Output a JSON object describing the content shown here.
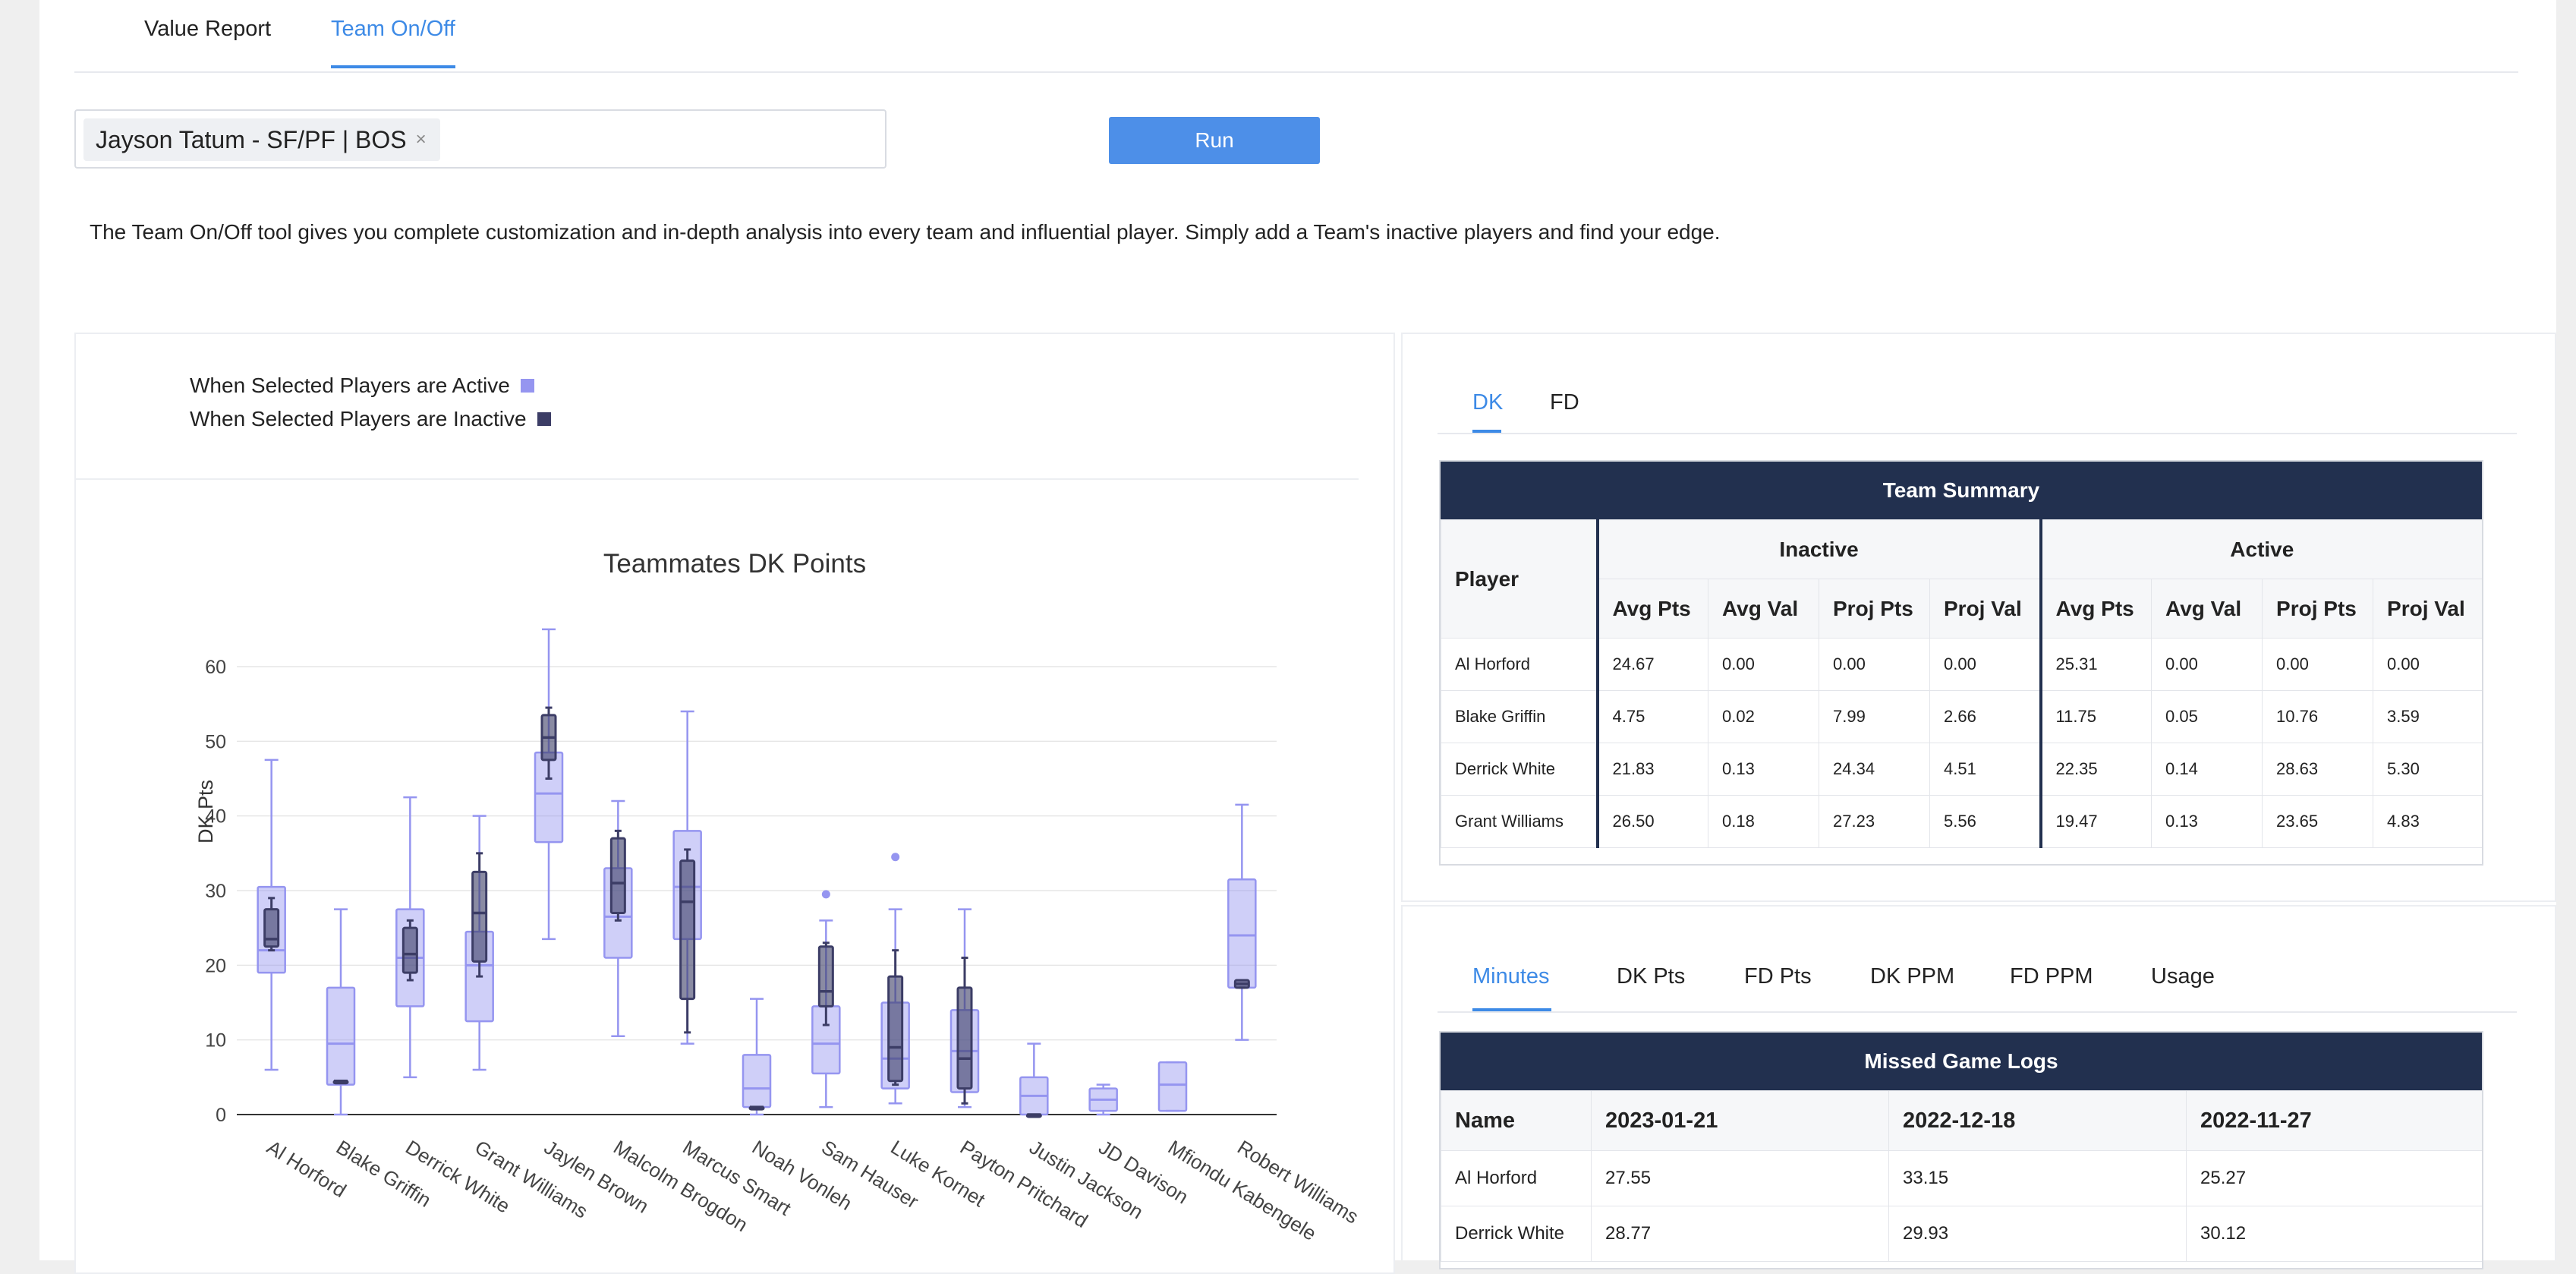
{
  "main_tabs": [
    {
      "label": "Value Report",
      "active": false
    },
    {
      "label": "Team On/Off",
      "active": true
    }
  ],
  "player_select": {
    "chip_label": "Jayson Tatum - SF/PF | BOS",
    "remove_glyph": "×"
  },
  "run_button": {
    "label": "Run"
  },
  "description": "The Team On/Off tool gives you complete customization and in-depth analysis into every team and influential player. Simply add a Team's inactive players and find your edge.",
  "legend": [
    {
      "label": "When Selected Players are Active",
      "color": "#9595f0"
    },
    {
      "label": "When Selected Players are Inactive",
      "color": "#3c3d66"
    }
  ],
  "chart_data": {
    "type": "box",
    "title": "Teammates DK Points",
    "xlabel": "",
    "ylabel": "DK Pts",
    "ylim": [
      -3,
      70
    ],
    "yticks": [
      0,
      10,
      20,
      30,
      40,
      50,
      60
    ],
    "grid": true,
    "categories": [
      "Al Horford",
      "Blake Griffin",
      "Derrick White",
      "Grant Williams",
      "Jaylen Brown",
      "Malcolm Brogdon",
      "Marcus Smart",
      "Noah Vonleh",
      "Sam Hauser",
      "Luke Kornet",
      "Payton Pritchard",
      "Justin Jackson",
      "JD Davison",
      "Mfiondu Kabengele",
      "Robert Williams"
    ],
    "series": [
      {
        "name": "When Selected Players are Active",
        "color": "#9595f0",
        "boxes": [
          {
            "min": 6,
            "q1": 19,
            "median": 22,
            "q3": 30.5,
            "max": 47.5
          },
          {
            "min": 0,
            "q1": 4,
            "median": 9.5,
            "q3": 17,
            "max": 27.5
          },
          {
            "min": 5,
            "q1": 14.5,
            "median": 21,
            "q3": 27.5,
            "max": 42.5
          },
          {
            "min": 6,
            "q1": 12.5,
            "median": 20,
            "q3": 24.5,
            "max": 40
          },
          {
            "min": 23.5,
            "q1": 36.5,
            "median": 43,
            "q3": 48.5,
            "max": 65
          },
          {
            "min": 10.5,
            "q1": 21,
            "median": 26.5,
            "q3": 33,
            "max": 42
          },
          {
            "min": 9.5,
            "q1": 23.5,
            "median": 30.5,
            "q3": 38,
            "max": 54
          },
          {
            "min": 0,
            "q1": 1,
            "median": 3.5,
            "q3": 8,
            "max": 15.5
          },
          {
            "min": 1,
            "q1": 5.5,
            "median": 9.5,
            "q3": 14.5,
            "max": 26,
            "outliers": [
              29.5
            ]
          },
          {
            "min": 1.5,
            "q1": 3.5,
            "median": 7.5,
            "q3": 15,
            "max": 27.5,
            "outliers": [
              34.5
            ]
          },
          {
            "min": 1,
            "q1": 3,
            "median": 8.5,
            "q3": 14,
            "max": 27.5
          },
          {
            "min": 0,
            "q1": 0,
            "median": 2.5,
            "q3": 5,
            "max": 9.5
          },
          {
            "min": 0,
            "q1": 0.5,
            "median": 2,
            "q3": 3.5,
            "max": 4
          },
          {
            "min": 0.5,
            "q1": 0.5,
            "median": 4,
            "q3": 7,
            "max": 7
          },
          {
            "min": 10,
            "q1": 17,
            "median": 24,
            "q3": 31.5,
            "max": 41.5
          }
        ]
      },
      {
        "name": "When Selected Players are Inactive",
        "color": "#3c3d66",
        "boxes": [
          {
            "min": 22,
            "q1": 22.5,
            "median": 23.5,
            "q3": 27.5,
            "max": 29
          },
          {
            "min": 4.5,
            "q1": 4.5,
            "median": 4.5,
            "q3": 4.5,
            "max": 4.5
          },
          {
            "min": 18,
            "q1": 19,
            "median": 21.5,
            "q3": 25,
            "max": 26
          },
          {
            "min": 18.5,
            "q1": 20.5,
            "median": 27,
            "q3": 32.5,
            "max": 35
          },
          {
            "min": 45,
            "q1": 47.5,
            "median": 50.5,
            "q3": 53.5,
            "max": 54.5
          },
          {
            "min": 26,
            "q1": 27,
            "median": 31,
            "q3": 37,
            "max": 38
          },
          {
            "min": 11,
            "q1": 15.5,
            "median": 28.5,
            "q3": 34,
            "max": 35.5
          },
          {
            "min": 1,
            "q1": 1,
            "median": 1,
            "q3": 1,
            "max": 1
          },
          {
            "min": 12,
            "q1": 14.5,
            "median": 16.5,
            "q3": 22.5,
            "max": 23
          },
          {
            "min": 4,
            "q1": 4.5,
            "median": 9,
            "q3": 18.5,
            "max": 22
          },
          {
            "min": 1.5,
            "q1": 3.5,
            "median": 7.5,
            "q3": 17,
            "max": 21
          },
          {
            "min": 0,
            "q1": 0,
            "median": 0,
            "q3": 0,
            "max": 0
          },
          null,
          null,
          {
            "min": 17,
            "q1": 17,
            "median": 17.5,
            "q3": 18,
            "max": 18
          }
        ]
      }
    ]
  },
  "summary_tabs": [
    {
      "label": "DK",
      "active": true
    },
    {
      "label": "FD",
      "active": false
    }
  ],
  "team_summary": {
    "title": "Team Summary",
    "player_header": "Player",
    "group_inactive": "Inactive",
    "group_active": "Active",
    "col_headers": [
      "Avg Pts",
      "Avg Val",
      "Proj Pts",
      "Proj Val",
      "Avg Pts",
      "Avg Val",
      "Proj Pts",
      "Proj Val"
    ],
    "rows": [
      {
        "player": "Al Horford",
        "values": [
          "24.67",
          "0.00",
          "0.00",
          "0.00",
          "25.31",
          "0.00",
          "0.00",
          "0.00"
        ]
      },
      {
        "player": "Blake Griffin",
        "values": [
          "4.75",
          "0.02",
          "7.99",
          "2.66",
          "11.75",
          "0.05",
          "10.76",
          "3.59"
        ]
      },
      {
        "player": "Derrick White",
        "values": [
          "21.83",
          "0.13",
          "24.34",
          "4.51",
          "22.35",
          "0.14",
          "28.63",
          "5.30"
        ]
      },
      {
        "player": "Grant Williams",
        "values": [
          "26.50",
          "0.18",
          "27.23",
          "5.56",
          "19.47",
          "0.13",
          "23.65",
          "4.83"
        ]
      }
    ]
  },
  "log_tabs": [
    {
      "label": "Minutes",
      "active": true
    },
    {
      "label": "DK Pts",
      "active": false
    },
    {
      "label": "FD Pts",
      "active": false
    },
    {
      "label": "DK PPM",
      "active": false
    },
    {
      "label": "FD PPM",
      "active": false
    },
    {
      "label": "Usage",
      "active": false
    }
  ],
  "missed_game_logs": {
    "title": "Missed Game Logs",
    "headers": [
      "Name",
      "2023-01-21",
      "2022-12-18",
      "2022-11-27"
    ],
    "rows": [
      {
        "name": "Al Horford",
        "values": [
          "27.55",
          "33.15",
          "25.27"
        ]
      },
      {
        "name": "Derrick White",
        "values": [
          "28.77",
          "29.93",
          "30.12"
        ]
      }
    ]
  }
}
